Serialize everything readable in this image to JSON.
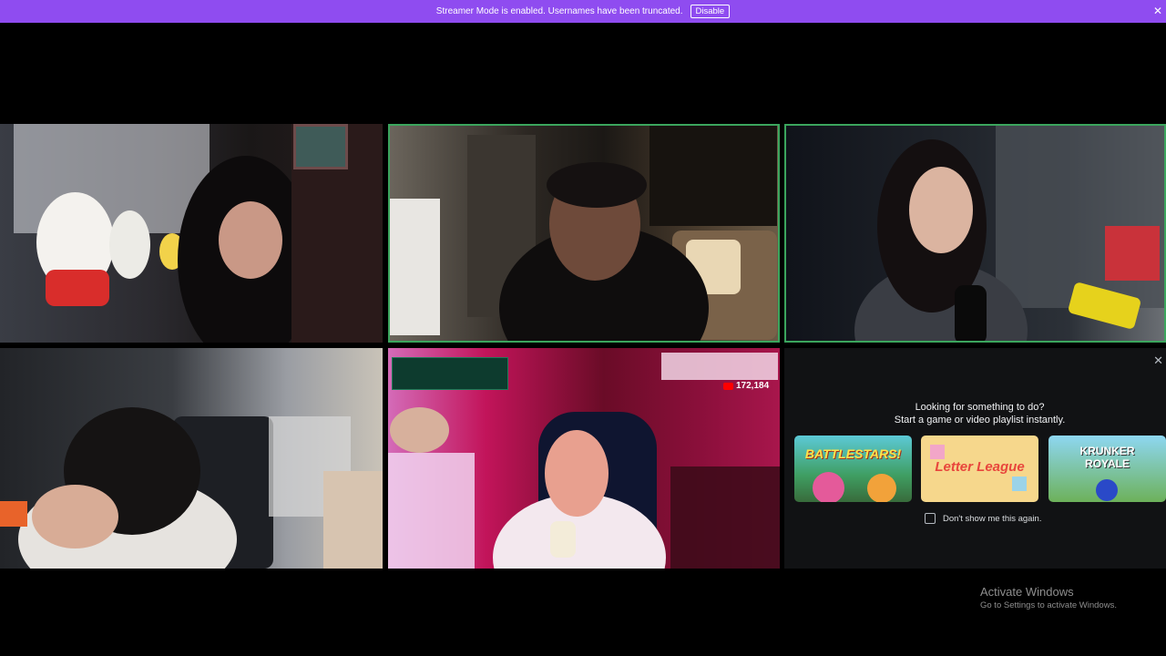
{
  "banner": {
    "message": "Streamer Mode is enabled. Usernames have been truncated.",
    "disable_label": "Disable",
    "close_glyph": "✕",
    "color": "#8f4cf0"
  },
  "tiles": {
    "speaking_border_color": "#3ba55d",
    "speaking": [
      false,
      true,
      true,
      false,
      false
    ]
  },
  "stream_overlay": {
    "youtube_count": "172,184"
  },
  "activity_panel": {
    "close_glyph": "✕",
    "title_line1": "Looking for something to do?",
    "title_line2": "Start a game or video playlist instantly.",
    "activities": [
      {
        "name": "BATTLESTARS!"
      },
      {
        "name": "Letter League"
      },
      {
        "name": "KRUNKER ROYALE"
      }
    ],
    "dont_show_label": "Don't show me this again."
  },
  "watermark": {
    "title": "Activate Windows",
    "subtitle": "Go to Settings to activate Windows."
  }
}
